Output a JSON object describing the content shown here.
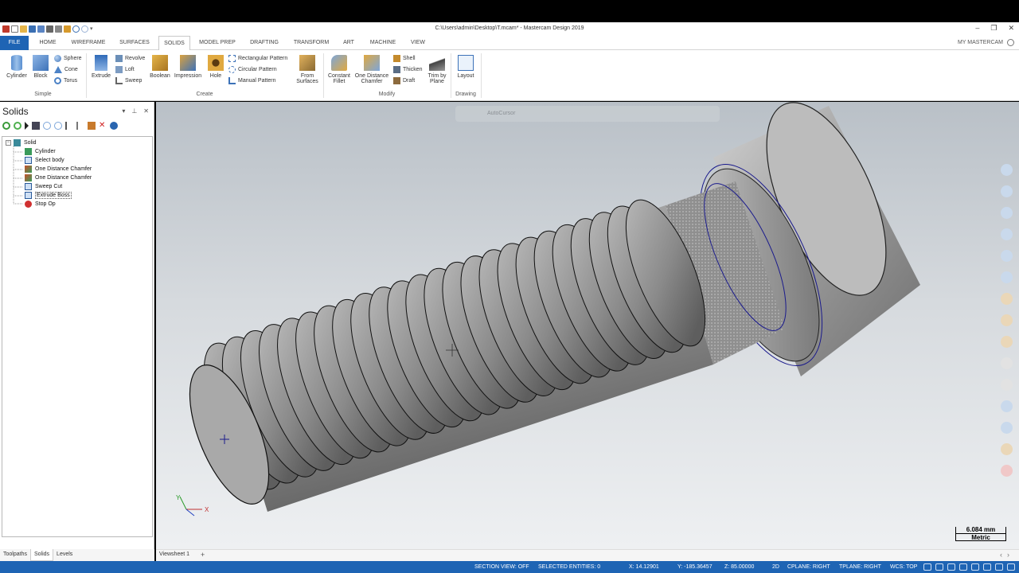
{
  "window": {
    "title": "C:\\Users\\admin\\Desktop\\T.mcam* - Mastercam Design 2019",
    "controls": [
      "–",
      "❐",
      "✕"
    ]
  },
  "tabs": [
    "FILE",
    "HOME",
    "WIREFRAME",
    "SURFACES",
    "SOLIDS",
    "MODEL PREP",
    "DRAFTING",
    "TRANSFORM",
    "ART",
    "MACHINE",
    "VIEW"
  ],
  "active_tab": "SOLIDS",
  "my_mastercam": "MY MASTERCAM",
  "ribbon": {
    "simple": {
      "label": "Simple",
      "cylinder": "Cylinder",
      "block": "Block",
      "sphere": "Sphere",
      "cone": "Cone",
      "torus": "Torus"
    },
    "create": {
      "label": "Create",
      "extrude": "Extrude",
      "revolve": "Revolve",
      "loft": "Loft",
      "sweep": "Sweep",
      "boolean": "Boolean",
      "impression": "Impression",
      "hole": "Hole",
      "rect_pattern": "Rectangular Pattern",
      "circ_pattern": "Circular Pattern",
      "manual_pattern": "Manual Pattern",
      "from_surfaces_1": "From",
      "from_surfaces_2": "Surfaces"
    },
    "modify": {
      "label": "Modify",
      "constant_fillet_1": "Constant",
      "constant_fillet_2": "Fillet",
      "one_distance_1": "One Distance",
      "one_distance_2": "Chamfer",
      "shell": "Shell",
      "thicken": "Thicken",
      "draft": "Draft",
      "trim_1": "Trim by",
      "trim_2": "Plane"
    },
    "drawing": {
      "label": "Drawing",
      "layout": "Layout"
    }
  },
  "panel": {
    "title": "Solids",
    "tree": [
      {
        "label": "Solid",
        "level": 0,
        "icon": "solid-icon"
      },
      {
        "label": "Cylinder",
        "level": 1,
        "icon": "cylinder-op-icon"
      },
      {
        "label": "Select body",
        "level": 1,
        "icon": "select-body-icon"
      },
      {
        "label": "One Distance Chamfer",
        "level": 1,
        "icon": "chamfer-icon"
      },
      {
        "label": "One Distance Chamfer",
        "level": 1,
        "icon": "chamfer-icon"
      },
      {
        "label": "Sweep Cut",
        "level": 1,
        "icon": "sweep-cut-icon"
      },
      {
        "label": "Extrude Boss",
        "level": 1,
        "icon": "extrude-boss-icon"
      },
      {
        "label": "Stop Op",
        "level": 1,
        "icon": "stop-op-icon"
      }
    ],
    "selected_index": 6
  },
  "manager_tabs": [
    "Toolpaths",
    "Solids",
    "Levels"
  ],
  "active_manager_tab": "Solids",
  "viewport": {
    "autocursor": "AutoCursor",
    "scale_value": "6.084 mm",
    "scale_unit": "Metric",
    "axis_x": "X",
    "axis_y": "Y"
  },
  "viewsheet": "Viewsheet 1",
  "status": {
    "section_view": "SECTION VIEW: OFF",
    "selected": "SELECTED ENTITIES: 0",
    "x": "X:  14.12901",
    "y": "Y:  -185.36457",
    "z": "Z:  85.00000",
    "mode": "2D",
    "cplane": "CPLANE: RIGHT",
    "tplane": "TPLANE: RIGHT",
    "wcs": "WCS: TOP"
  },
  "colors": {
    "accent": "#1e64b4",
    "status_bar": "#1e64b4",
    "viewport_top": "#b9c0c7",
    "viewport_bottom": "#eef0f2",
    "solid_gray": "#8c8c8c",
    "edge_blue": "#1a1a8c"
  }
}
